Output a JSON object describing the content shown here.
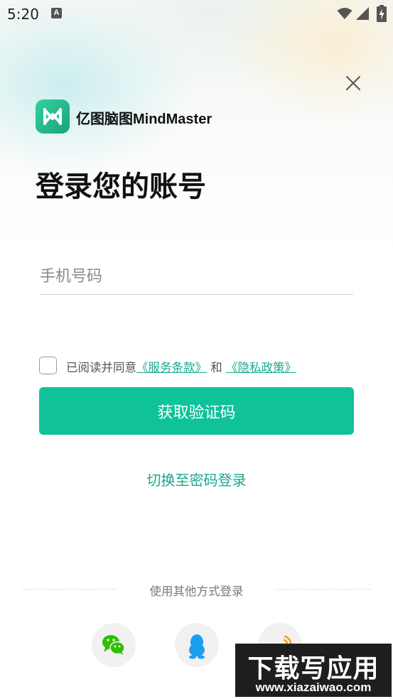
{
  "status_bar": {
    "time": "5:20",
    "notification_letter": "A",
    "icons": [
      "a-notification-icon",
      "wifi-icon",
      "signal-icon",
      "battery-charging-icon"
    ]
  },
  "header": {
    "app_name": "亿图脑图MindMaster",
    "logo_icon": "mindmaster-logo-icon",
    "close_icon": "close-icon"
  },
  "login": {
    "title": "登录您的账号",
    "phone_placeholder": "手机号码",
    "agreement": {
      "prefix": "已阅读并同意",
      "terms_link": "《服务条款》",
      "conjunction": "和",
      "privacy_link": "《隐私政策》"
    },
    "get_code_button": "获取验证码",
    "switch_to_password": "切换至密码登录",
    "other_methods_label": "使用其他方式登录",
    "social": [
      "wechat-icon",
      "qq-icon",
      "weibo-icon"
    ]
  },
  "watermark": {
    "title": "下载写应用",
    "url": "www.xiazaiwao.com"
  },
  "colors": {
    "accent": "#10c29a",
    "link": "#19a98a",
    "text_primary": "#111111",
    "placeholder": "#8a8a8a"
  }
}
